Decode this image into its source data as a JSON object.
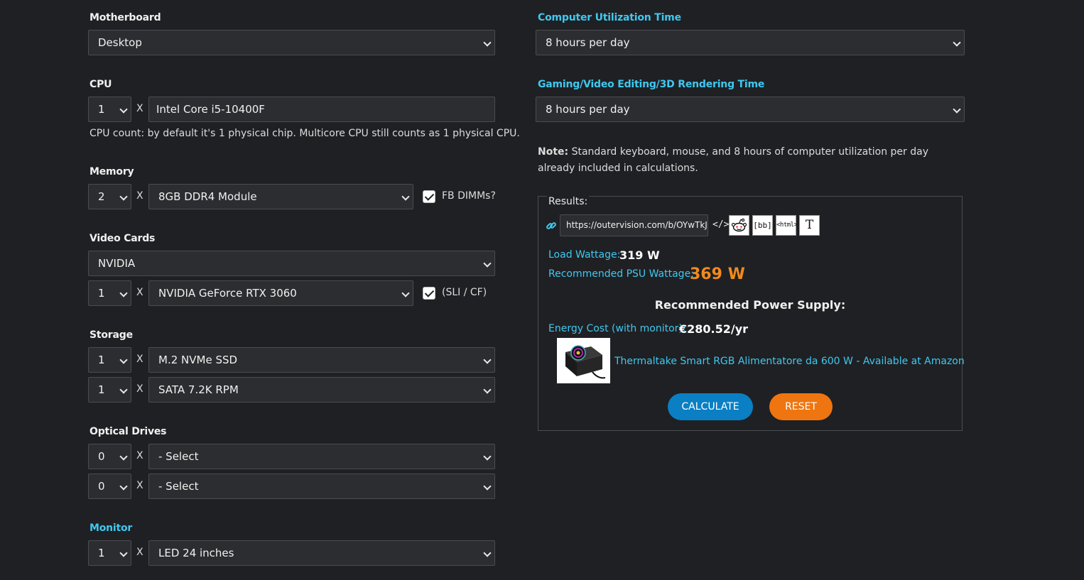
{
  "motherboard": {
    "label": "Motherboard",
    "value": "Desktop"
  },
  "cpu": {
    "label": "CPU",
    "count": "1",
    "x": "X",
    "model": "Intel Core i5-10400F",
    "note": "CPU count: by default it's 1 physical chip. Multicore CPU still counts as 1 physical CPU."
  },
  "memory": {
    "label": "Memory",
    "count": "2",
    "x": "X",
    "module": "8GB DDR4 Module",
    "fb_label": "FB DIMMs?",
    "fb_checked": true
  },
  "video": {
    "label": "Video Cards",
    "brand": "NVIDIA",
    "count": "1",
    "x": "X",
    "model": "NVIDIA GeForce RTX 3060",
    "sli_label": "(SLI / CF)",
    "sli_checked": true
  },
  "storage": {
    "label": "Storage",
    "rows": [
      {
        "count": "1",
        "x": "X",
        "type": "M.2 NVMe SSD"
      },
      {
        "count": "1",
        "x": "X",
        "type": "SATA 7.2K RPM"
      }
    ]
  },
  "optical": {
    "label": "Optical Drives",
    "rows": [
      {
        "count": "0",
        "x": "X",
        "type": "- Select"
      },
      {
        "count": "0",
        "x": "X",
        "type": "- Select"
      }
    ]
  },
  "monitor": {
    "label": "Monitor",
    "count": "1",
    "x": "X",
    "type": "LED 24 inches"
  },
  "utilization": {
    "label": "Computer Utilization Time",
    "value": "8 hours per day"
  },
  "gaming": {
    "label": "Gaming/Video Editing/3D Rendering Time",
    "value": "8 hours per day"
  },
  "note": {
    "bold": "Note:",
    "text": " Standard keyboard, mouse, and 8 hours of computer utilization per day already included in calculations."
  },
  "results": {
    "legend": "Results:",
    "share_url": "https://outervision.com/b/OYwTkJ",
    "share_buttons": {
      "embed": "</>",
      "bb": "[bb]",
      "html": "<html>",
      "text": "T"
    },
    "load_label": "Load Wattage:",
    "load_value": "319 W",
    "psu_label": "Recommended PSU Wattage:",
    "psu_value": "369 W",
    "recommended_heading": "Recommended Power Supply:",
    "energy_label": "Energy Cost (with monitor):",
    "energy_value": "€280.52/yr",
    "product_link": "Thermaltake Smart RGB Alimentatore da 600 W - Available at Amazon",
    "calculate_label": "CALCULATE",
    "reset_label": "RESET"
  },
  "colors": {
    "background": "#1f2023",
    "accent_cyan": "#3fc8f0",
    "accent_orange": "#f08a1e",
    "calculate_blue": "#0a7fc4",
    "reset_orange": "#ef7510"
  }
}
